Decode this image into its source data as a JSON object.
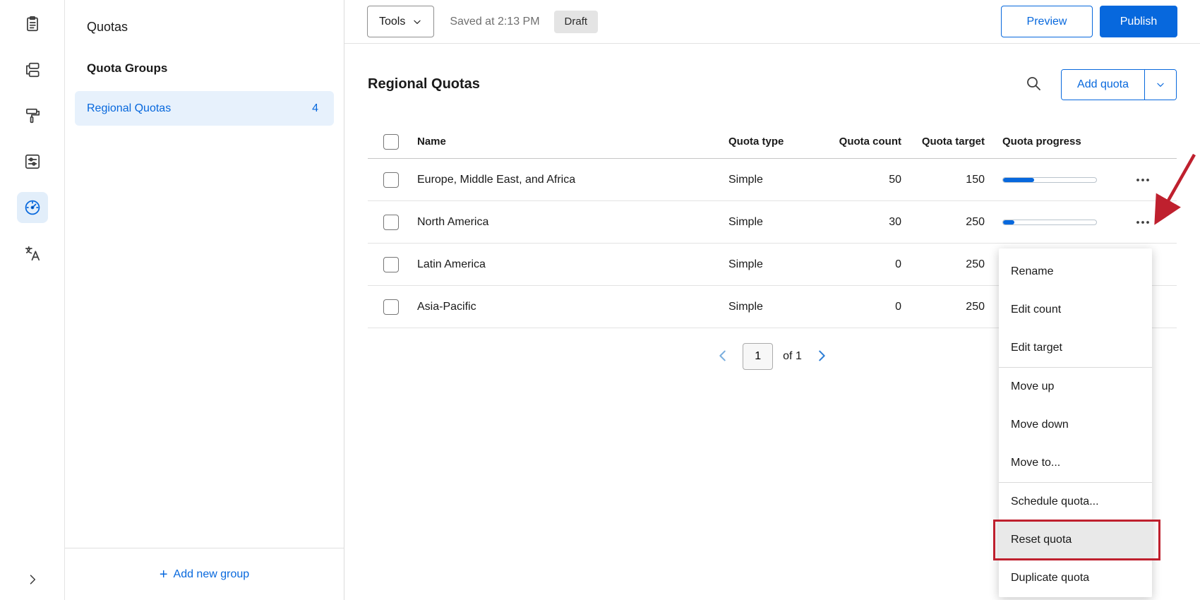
{
  "colors": {
    "accent": "#0768dd",
    "annotation": "#bf202e",
    "selected_nav_bg": "#e7f1fc"
  },
  "rail": {
    "items": [
      {
        "name": "survey-builder",
        "icon": "clipboard-icon",
        "selected": false
      },
      {
        "name": "survey-flow",
        "icon": "blocks-icon",
        "selected": false
      },
      {
        "name": "look-and-feel",
        "icon": "paint-roller-icon",
        "selected": false
      },
      {
        "name": "survey-options",
        "icon": "sliders-icon",
        "selected": false
      },
      {
        "name": "quotas",
        "icon": "gauge-icon",
        "selected": true
      },
      {
        "name": "translations",
        "icon": "translate-icon",
        "selected": false
      }
    ]
  },
  "nav_panel": {
    "title": "Quotas",
    "section_label": "Quota Groups",
    "groups": [
      {
        "label": "Regional Quotas",
        "count": "4",
        "selected": true
      }
    ],
    "add_group_label": "Add new group",
    "add_group_plus": "+"
  },
  "topbar": {
    "tools_label": "Tools",
    "saved_text": "Saved at 2:13 PM",
    "draft_badge": "Draft",
    "preview_label": "Preview",
    "publish_label": "Publish"
  },
  "content": {
    "title": "Regional Quotas",
    "add_quota_label": "Add quota",
    "table": {
      "columns": [
        "Name",
        "Quota type",
        "Quota count",
        "Quota target",
        "Quota progress"
      ],
      "rows": [
        {
          "name": "Europe, Middle East, and Africa",
          "type": "Simple",
          "count": "50",
          "target": "150"
        },
        {
          "name": "North America",
          "type": "Simple",
          "count": "30",
          "target": "250"
        },
        {
          "name": "Latin America",
          "type": "Simple",
          "count": "0",
          "target": "250"
        },
        {
          "name": "Asia-Pacific",
          "type": "Simple",
          "count": "0",
          "target": "250"
        }
      ]
    },
    "pagination": {
      "page": "1",
      "of_label": "of 1"
    }
  },
  "context_menu": {
    "items": [
      {
        "label": "Rename"
      },
      {
        "label": "Edit count"
      },
      {
        "label": "Edit target",
        "divider_after": true
      },
      {
        "label": "Move up"
      },
      {
        "label": "Move down"
      },
      {
        "label": "Move to...",
        "divider_after": true
      },
      {
        "label": "Schedule quota..."
      },
      {
        "label": "Reset quota",
        "highlighted": true
      },
      {
        "label": "Duplicate quota"
      }
    ]
  }
}
